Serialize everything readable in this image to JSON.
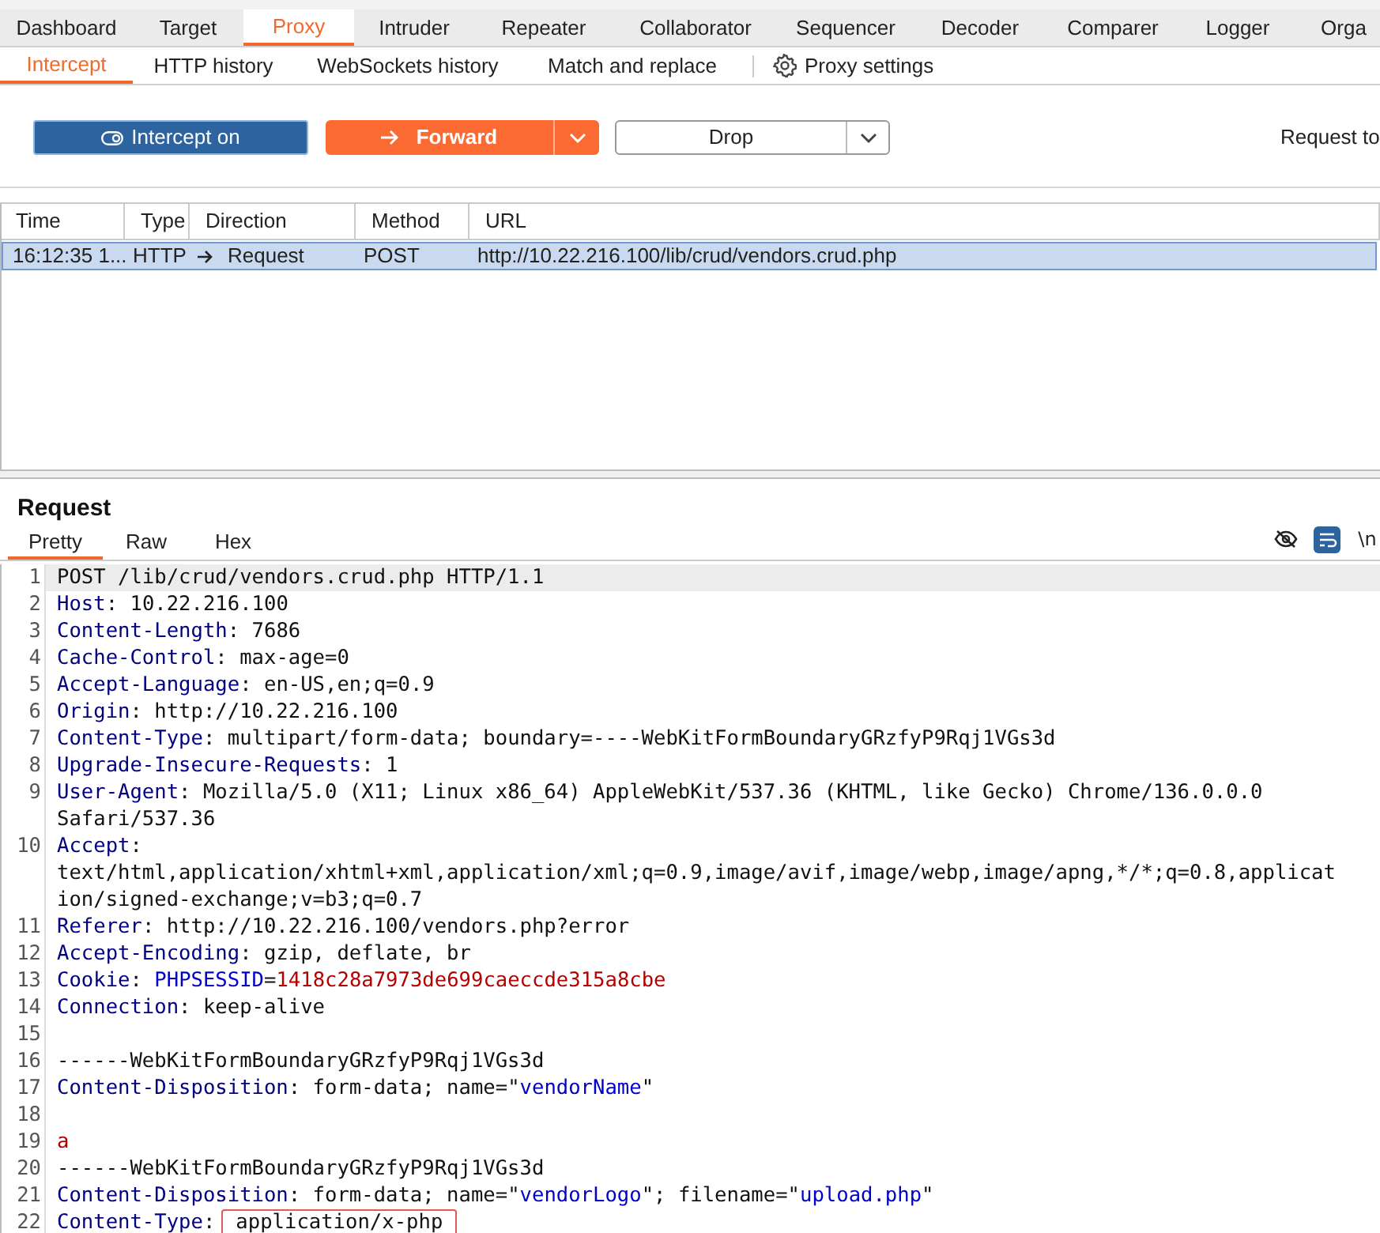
{
  "main_tabs": [
    {
      "label": "Dashboard",
      "selected": false
    },
    {
      "label": "Target",
      "selected": false
    },
    {
      "label": "Proxy",
      "selected": true
    },
    {
      "label": "Intruder",
      "selected": false
    },
    {
      "label": "Repeater",
      "selected": false
    },
    {
      "label": "Collaborator",
      "selected": false
    },
    {
      "label": "Sequencer",
      "selected": false
    },
    {
      "label": "Decoder",
      "selected": false
    },
    {
      "label": "Comparer",
      "selected": false
    },
    {
      "label": "Logger",
      "selected": false
    },
    {
      "label": "Orga",
      "selected": false
    }
  ],
  "sub_tabs": [
    {
      "label": "Intercept",
      "selected": true
    },
    {
      "label": "HTTP history",
      "selected": false
    },
    {
      "label": "WebSockets history",
      "selected": false
    },
    {
      "label": "Match and replace",
      "selected": false
    }
  ],
  "proxy_settings": "Proxy settings",
  "toolbar": {
    "intercept": {
      "label": "Intercept on",
      "on": true
    },
    "forward": "Forward",
    "drop": "Drop",
    "request_to": "Request to"
  },
  "table": {
    "columns": [
      "Time",
      "Type",
      "Direction",
      "Method",
      "URL"
    ],
    "rows": [
      {
        "selected": true,
        "cells": [
          "16:12:35 1...",
          "HTTP",
          "Request",
          "POST",
          "http://10.22.216.100/lib/crud/vendors.crud.php"
        ]
      }
    ]
  },
  "request": {
    "title": "Request",
    "tabs": [
      {
        "label": "Pretty",
        "selected": true
      },
      {
        "label": "Raw",
        "selected": false
      },
      {
        "label": "Hex",
        "selected": false
      }
    ],
    "newline_toggle": "\\n",
    "lines": [
      {
        "num": "1",
        "highlighted": true,
        "segments": [
          {
            "kind": "plain",
            "text": "POST /lib/crud/vendors.crud.php HTTP/1.1"
          }
        ]
      },
      {
        "num": "2",
        "segments": [
          {
            "kind": "key",
            "text": "Host"
          },
          {
            "kind": "plain",
            "text": ": 10.22.216.100"
          }
        ]
      },
      {
        "num": "3",
        "segments": [
          {
            "kind": "key",
            "text": "Content-Length"
          },
          {
            "kind": "plain",
            "text": ": 7686"
          }
        ]
      },
      {
        "num": "4",
        "segments": [
          {
            "kind": "key",
            "text": "Cache-Control"
          },
          {
            "kind": "plain",
            "text": ": max-age=0"
          }
        ]
      },
      {
        "num": "5",
        "segments": [
          {
            "kind": "key",
            "text": "Accept-Language"
          },
          {
            "kind": "plain",
            "text": ": en-US,en;q=0.9"
          }
        ]
      },
      {
        "num": "6",
        "segments": [
          {
            "kind": "key",
            "text": "Origin"
          },
          {
            "kind": "plain",
            "text": ": http://10.22.216.100"
          }
        ]
      },
      {
        "num": "7",
        "segments": [
          {
            "kind": "key",
            "text": "Content-Type"
          },
          {
            "kind": "plain",
            "text": ": multipart/form-data; boundary=----WebKitFormBoundaryGRzfyP9Rqj1VGs3d"
          }
        ]
      },
      {
        "num": "8",
        "segments": [
          {
            "kind": "key",
            "text": "Upgrade-Insecure-Requests"
          },
          {
            "kind": "plain",
            "text": ": 1"
          }
        ]
      },
      {
        "num": "9",
        "segments": [
          {
            "kind": "key",
            "text": "User-Agent"
          },
          {
            "kind": "plain",
            "text": ": Mozilla/5.0 (X11; Linux x86_64) AppleWebKit/537.36 (KHTML, like Gecko) Chrome/136.0.0.0"
          }
        ]
      },
      {
        "segments": [
          {
            "kind": "plain",
            "text": "Safari/537.36"
          }
        ]
      },
      {
        "num": "10",
        "segments": [
          {
            "kind": "key",
            "text": "Accept"
          },
          {
            "kind": "plain",
            "text": ":"
          }
        ]
      },
      {
        "segments": [
          {
            "kind": "plain",
            "text": "text/html,application/xhtml+xml,application/xml;q=0.9,image/avif,image/webp,image/apng,*/*;q=0.8,applicat"
          }
        ]
      },
      {
        "segments": [
          {
            "kind": "plain",
            "text": "ion/signed-exchange;v=b3;q=0.7"
          }
        ]
      },
      {
        "num": "11",
        "segments": [
          {
            "kind": "key",
            "text": "Referer"
          },
          {
            "kind": "plain",
            "text": ": http://10.22.216.100/vendors.php?error"
          }
        ]
      },
      {
        "num": "12",
        "segments": [
          {
            "kind": "key",
            "text": "Accept-Encoding"
          },
          {
            "kind": "plain",
            "text": ": gzip, deflate, br"
          }
        ]
      },
      {
        "num": "13",
        "segments": [
          {
            "kind": "key",
            "text": "Cookie"
          },
          {
            "kind": "plain",
            "text": ": "
          },
          {
            "kind": "name",
            "text": "PHPSESSID"
          },
          {
            "kind": "plain",
            "text": "="
          },
          {
            "kind": "value",
            "text": "1418c28a7973de699caeccde315a8cbe"
          }
        ]
      },
      {
        "num": "14",
        "segments": [
          {
            "kind": "key",
            "text": "Connection"
          },
          {
            "kind": "plain",
            "text": ": keep-alive"
          }
        ]
      },
      {
        "num": "15"
      },
      {
        "num": "16",
        "segments": [
          {
            "kind": "plain",
            "text": "------WebKitFormBoundaryGRzfyP9Rqj1VGs3d"
          }
        ]
      },
      {
        "num": "17",
        "segments": [
          {
            "kind": "key",
            "text": "Content-Disposition"
          },
          {
            "kind": "plain",
            "text": ": form-data; name=\""
          },
          {
            "kind": "name",
            "text": "vendorName"
          },
          {
            "kind": "plain",
            "text": "\""
          }
        ]
      },
      {
        "num": "18"
      },
      {
        "num": "19",
        "segments": [
          {
            "kind": "value",
            "text": "a"
          }
        ]
      },
      {
        "num": "20",
        "segments": [
          {
            "kind": "plain",
            "text": "------WebKitFormBoundaryGRzfyP9Rqj1VGs3d"
          }
        ]
      },
      {
        "num": "21",
        "segments": [
          {
            "kind": "key",
            "text": "Content-Disposition"
          },
          {
            "kind": "plain",
            "text": ": form-data; name=\""
          },
          {
            "kind": "name",
            "text": "vendorLogo"
          },
          {
            "kind": "plain",
            "text": "\"; filename=\""
          },
          {
            "kind": "name",
            "text": "upload.php"
          },
          {
            "kind": "plain",
            "text": "\""
          }
        ]
      },
      {
        "num": "22",
        "segments": [
          {
            "kind": "key",
            "text": "Content-Type"
          },
          {
            "kind": "plain",
            "text": ":"
          },
          {
            "kind": "boxed",
            "text": "application/x-php"
          }
        ]
      }
    ]
  }
}
